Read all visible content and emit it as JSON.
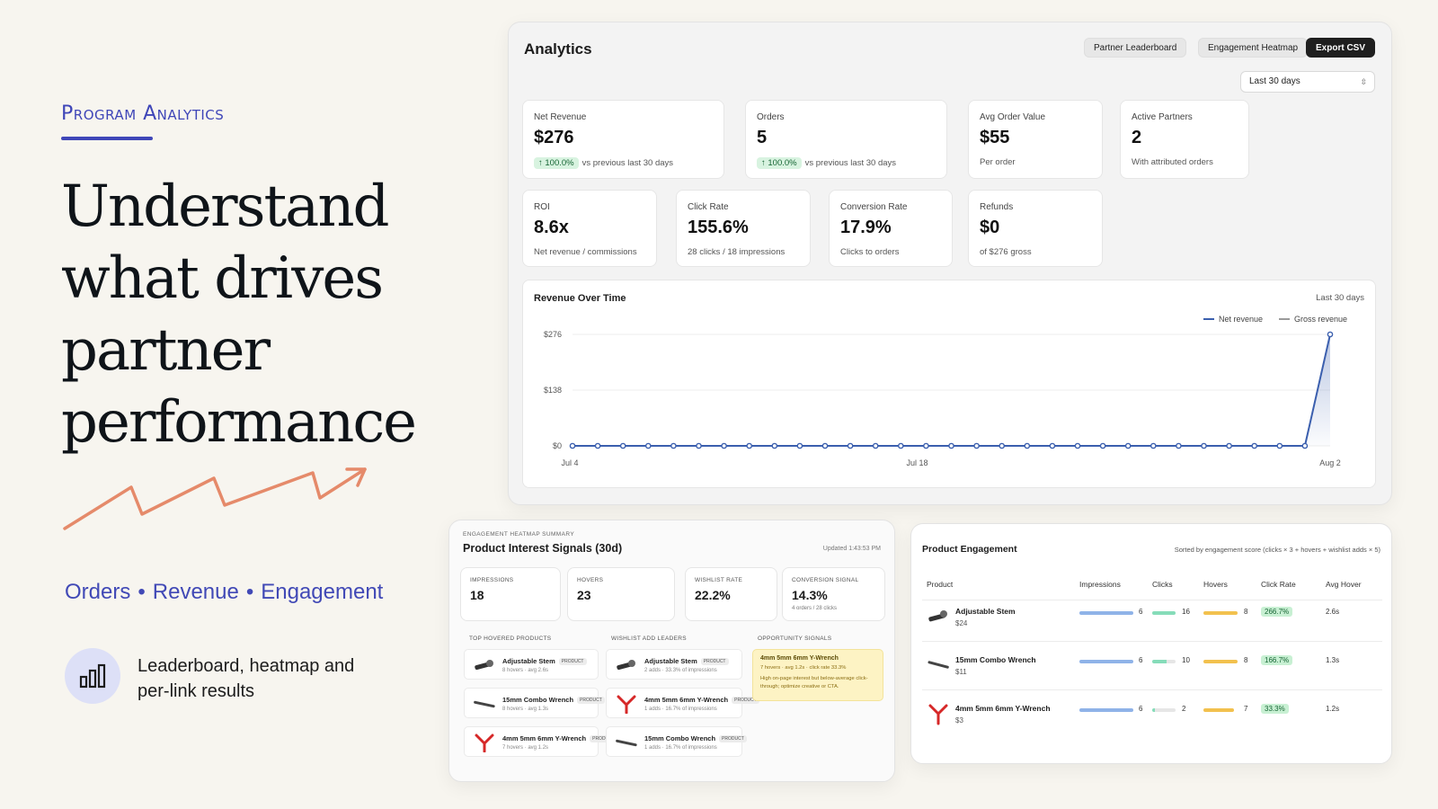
{
  "hero": {
    "eyebrow": "Program Analytics",
    "headline": "Understand what drives partner performance",
    "pillars": [
      "Orders",
      "Revenue",
      "Engagement"
    ],
    "feature_text": "Leaderboard, heatmap and per-link results"
  },
  "analytics": {
    "title": "Analytics",
    "buttons": {
      "leaderboard": "Partner Leaderboard",
      "heatmap": "Engagement Heatmap",
      "export": "Export CSV"
    },
    "range": "Last 30 days",
    "kpis": {
      "net_revenue": {
        "label": "Net Revenue",
        "value": "$276",
        "badge": "↑ 100.0%",
        "sub": "vs previous last 30 days"
      },
      "orders": {
        "label": "Orders",
        "value": "5",
        "badge": "↑ 100.0%",
        "sub": "vs previous last 30 days"
      },
      "aov": {
        "label": "Avg Order Value",
        "value": "$55",
        "sub": "Per order"
      },
      "partners": {
        "label": "Active Partners",
        "value": "2",
        "sub": "With attributed orders"
      },
      "roi": {
        "label": "ROI",
        "value": "8.6x",
        "sub": "Net revenue / commissions"
      },
      "click_rate": {
        "label": "Click Rate",
        "value": "155.6%",
        "sub": "28 clicks / 18 impressions"
      },
      "conversion": {
        "label": "Conversion Rate",
        "value": "17.9%",
        "sub": "Clicks to orders"
      },
      "refunds": {
        "label": "Refunds",
        "value": "$0",
        "sub": "of $276 gross"
      }
    },
    "chart_title": "Revenue Over Time",
    "chart_range": "Last 30 days"
  },
  "chart_data": {
    "type": "line",
    "title": "Revenue Over Time",
    "x_tick_labels": [
      "Jul 4",
      "Jul 18",
      "Aug 2"
    ],
    "y_tick_labels": [
      "$0",
      "$138",
      "$276"
    ],
    "ylim": [
      0,
      276
    ],
    "series": [
      {
        "name": "Net revenue",
        "color": "#3b5fae",
        "values": [
          0,
          0,
          0,
          0,
          0,
          0,
          0,
          0,
          0,
          0,
          0,
          0,
          0,
          0,
          0,
          0,
          0,
          0,
          0,
          0,
          0,
          0,
          0,
          0,
          0,
          0,
          0,
          0,
          0,
          0,
          276
        ]
      },
      {
        "name": "Gross revenue",
        "color": "#9a9a9a",
        "values": []
      }
    ],
    "legend": "top-right",
    "grid": true
  },
  "interest": {
    "eyebrow": "ENGAGEMENT HEATMAP SUMMARY",
    "title": "Product Interest Signals (30d)",
    "updated": "Updated 1:43:53 PM",
    "metrics": {
      "impressions": {
        "label": "IMPRESSIONS",
        "value": "18"
      },
      "hovers": {
        "label": "HOVERS",
        "value": "23"
      },
      "wishlist": {
        "label": "WISHLIST RATE",
        "value": "22.2%"
      },
      "conversion": {
        "label": "CONVERSION SIGNAL",
        "value": "14.3%",
        "sub": "4 orders / 28 clicks"
      }
    },
    "cols": {
      "hovered": "TOP HOVERED PRODUCTS",
      "wishlist": "WISHLIST ADD LEADERS",
      "opportunity": "OPPORTUNITY SIGNALS"
    },
    "tag": "PRODUCT",
    "hovered": [
      {
        "name": "Adjustable Stem",
        "stat": "8 hovers · avg 2.6s"
      },
      {
        "name": "15mm Combo Wrench",
        "stat": "8 hovers · avg 1.3s"
      },
      {
        "name": "4mm 5mm 6mm Y-Wrench",
        "stat": "7 hovers · avg 1.2s"
      }
    ],
    "wishlist": [
      {
        "name": "Adjustable Stem",
        "stat": "2 adds · 33.3% of impressions"
      },
      {
        "name": "4mm 5mm 6mm Y-Wrench",
        "stat": "1 adds · 16.7% of impressions"
      },
      {
        "name": "15mm Combo Wrench",
        "stat": "1 adds · 16.7% of impressions"
      }
    ],
    "opportunity": {
      "title": "4mm 5mm 6mm Y-Wrench",
      "stat": "7 hovers · avg 1.2s · click rate 33.3%",
      "body": "High on-page interest but below-average click-through; optimize creative or CTA."
    }
  },
  "engagement": {
    "title": "Product Engagement",
    "sort": "Sorted by engagement score (clicks × 3 + hovers + wishlist adds × 5)",
    "headers": {
      "product": "Product",
      "impressions": "Impressions",
      "clicks": "Clicks",
      "hovers": "Hovers",
      "rate": "Click Rate",
      "avg": "Avg Hover"
    },
    "rows": [
      {
        "name": "Adjustable Stem",
        "price": "$24",
        "impressions": "6",
        "clicks": "16",
        "hovers": "8",
        "rate": "266.7%",
        "avg": "2.6s",
        "clicks_fill": 1.0
      },
      {
        "name": "15mm Combo Wrench",
        "price": "$11",
        "impressions": "6",
        "clicks": "10",
        "hovers": "8",
        "rate": "166.7%",
        "avg": "1.3s",
        "clicks_fill": 0.62
      },
      {
        "name": "4mm 5mm 6mm Y-Wrench",
        "price": "$3",
        "impressions": "6",
        "clicks": "2",
        "hovers": "7",
        "rate": "33.3%",
        "avg": "1.2s",
        "clicks_fill": 0.12
      }
    ]
  }
}
